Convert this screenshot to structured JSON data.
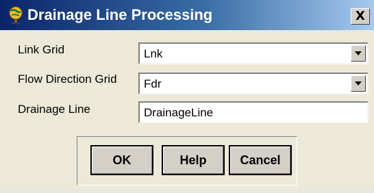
{
  "window": {
    "title": "Drainage Line Processing",
    "title_icon": "globe-person-icon",
    "close_label": "X"
  },
  "form": {
    "link_grid_label": "Link Grid",
    "link_grid_value": "Lnk",
    "flow_direction_label": "Flow Direction Grid",
    "flow_direction_value": "Fdr",
    "drainage_line_label": "Drainage Line",
    "drainage_line_value": "DrainageLine"
  },
  "buttons": {
    "ok": "OK",
    "help": "Help",
    "cancel": "Cancel"
  },
  "colors": {
    "titlebar_start": "#0a246a",
    "titlebar_end": "#a6caf0",
    "dialog_bg": "#ece9d8"
  }
}
